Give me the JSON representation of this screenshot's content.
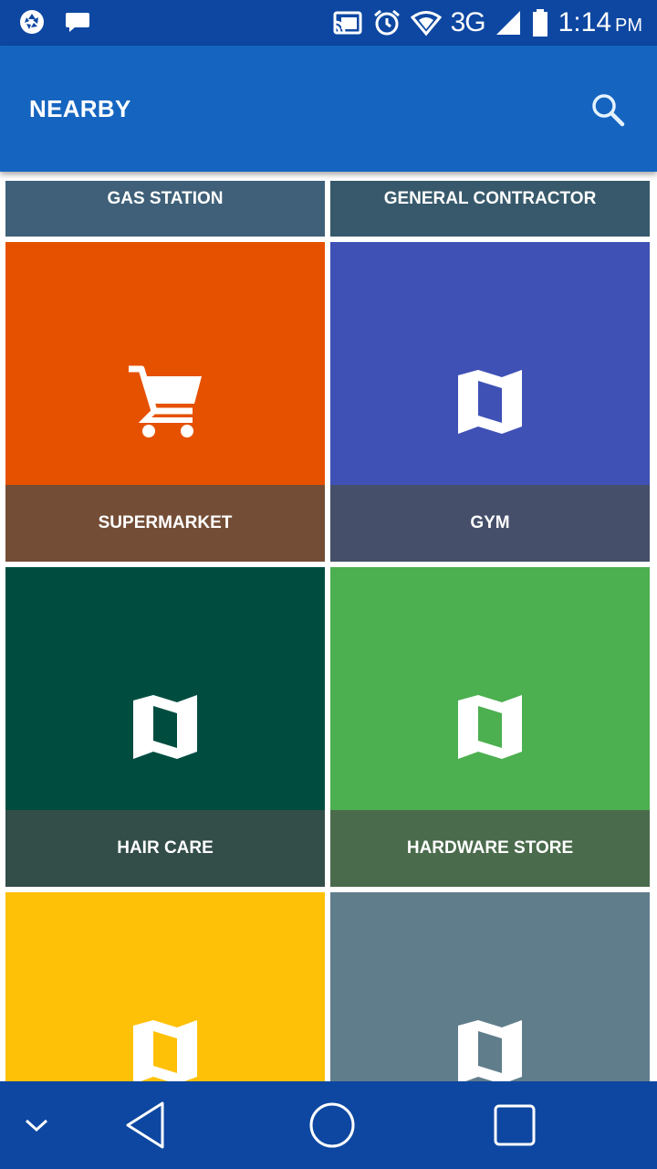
{
  "status_bar": {
    "time": "1:14",
    "ampm": "PM",
    "network": "3G"
  },
  "app_bar": {
    "title": "NEARBY"
  },
  "tiles": [
    {
      "label": "GAS STATION",
      "icon": "map-icon",
      "top_color": "#3f6078",
      "label_color": "#3f6078"
    },
    {
      "label": "GENERAL CONTRACTOR",
      "icon": "map-icon",
      "top_color": "#37596b",
      "label_color": "#37596b"
    },
    {
      "label": "SUPERMARKET",
      "icon": "shopping-cart-icon",
      "top_color": "#e65100",
      "label_color": "#744d36"
    },
    {
      "label": "GYM",
      "icon": "map-icon",
      "top_color": "#3f51b5",
      "label_color": "#454f6a"
    },
    {
      "label": "HAIR CARE",
      "icon": "map-icon",
      "top_color": "#004d40",
      "label_color": "#334d48"
    },
    {
      "label": "HARDWARE STORE",
      "icon": "map-icon",
      "top_color": "#4caf50",
      "label_color": "#4a6b4c"
    },
    {
      "label": "",
      "icon": "map-icon",
      "top_color": "#ffc107",
      "label_color": "#ffc107"
    },
    {
      "label": "",
      "icon": "map-icon",
      "top_color": "#607d8b",
      "label_color": "#607d8b"
    }
  ]
}
